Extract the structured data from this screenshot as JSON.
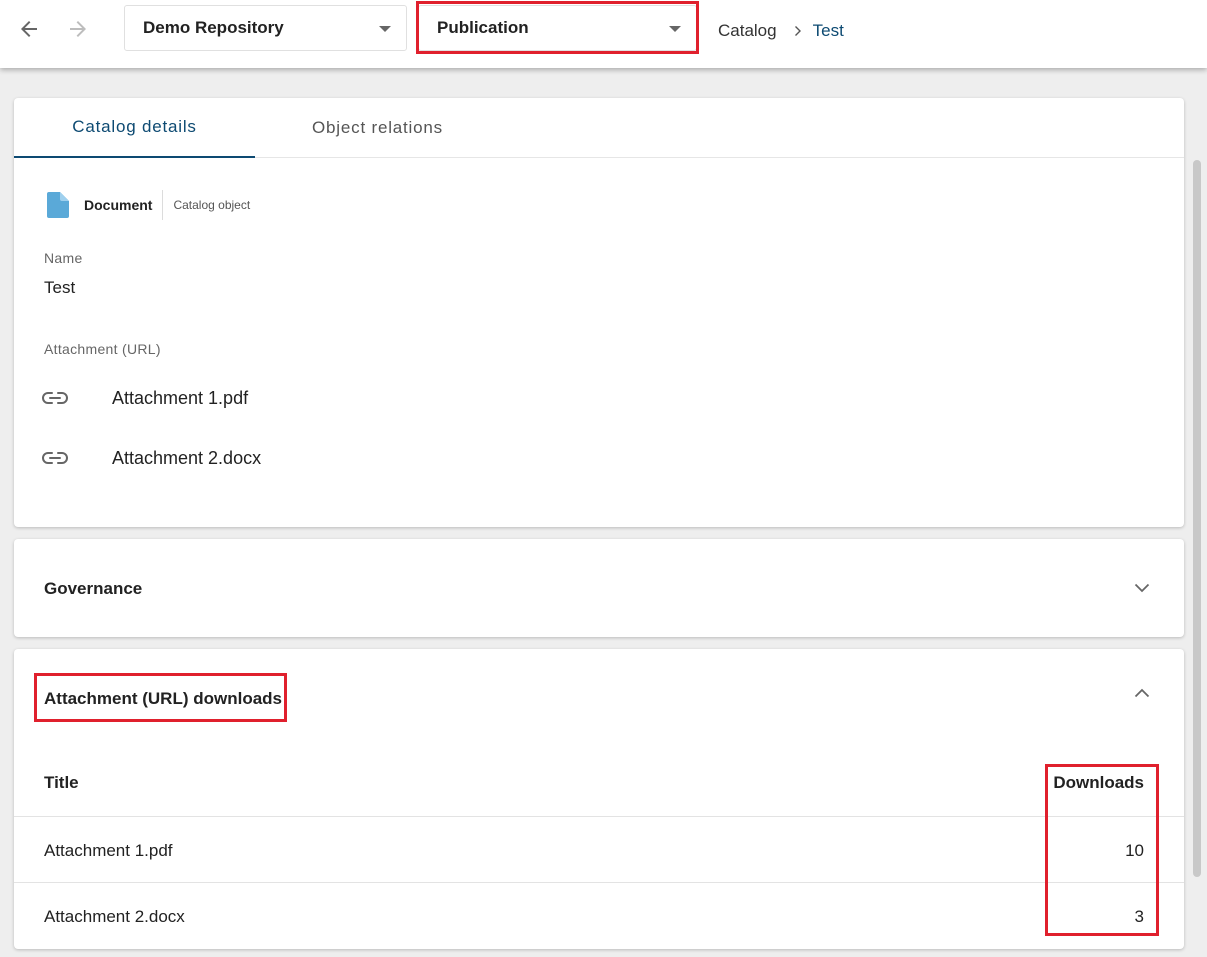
{
  "topbar": {
    "back_icon": "arrow-left-icon",
    "forward_icon": "arrow-right-icon",
    "repository_select": "Demo Repository",
    "scope_select": "Publication",
    "breadcrumb": [
      "Catalog",
      "Test"
    ]
  },
  "details": {
    "tabs": [
      "Catalog details",
      "Object relations"
    ],
    "active_tab": "Catalog details",
    "object_type": "Document",
    "object_kind": "Catalog object",
    "name_label": "Name",
    "name_value": "Test",
    "attachment_label": "Attachment (URL)",
    "attachments": [
      "Attachment 1.pdf",
      "Attachment 2.docx"
    ]
  },
  "governance": {
    "title": "Governance",
    "expanded": false
  },
  "downloads": {
    "title": "Attachment (URL) downloads",
    "expanded": true,
    "columns": [
      "Title",
      "Downloads"
    ],
    "rows": [
      {
        "title": "Attachment 1.pdf",
        "downloads": "10"
      },
      {
        "title": "Attachment 2.docx",
        "downloads": "3"
      }
    ]
  },
  "colors": {
    "accent": "#0d4a72",
    "highlight": "#e0202d",
    "doc_icon": "#5aa9d8"
  }
}
